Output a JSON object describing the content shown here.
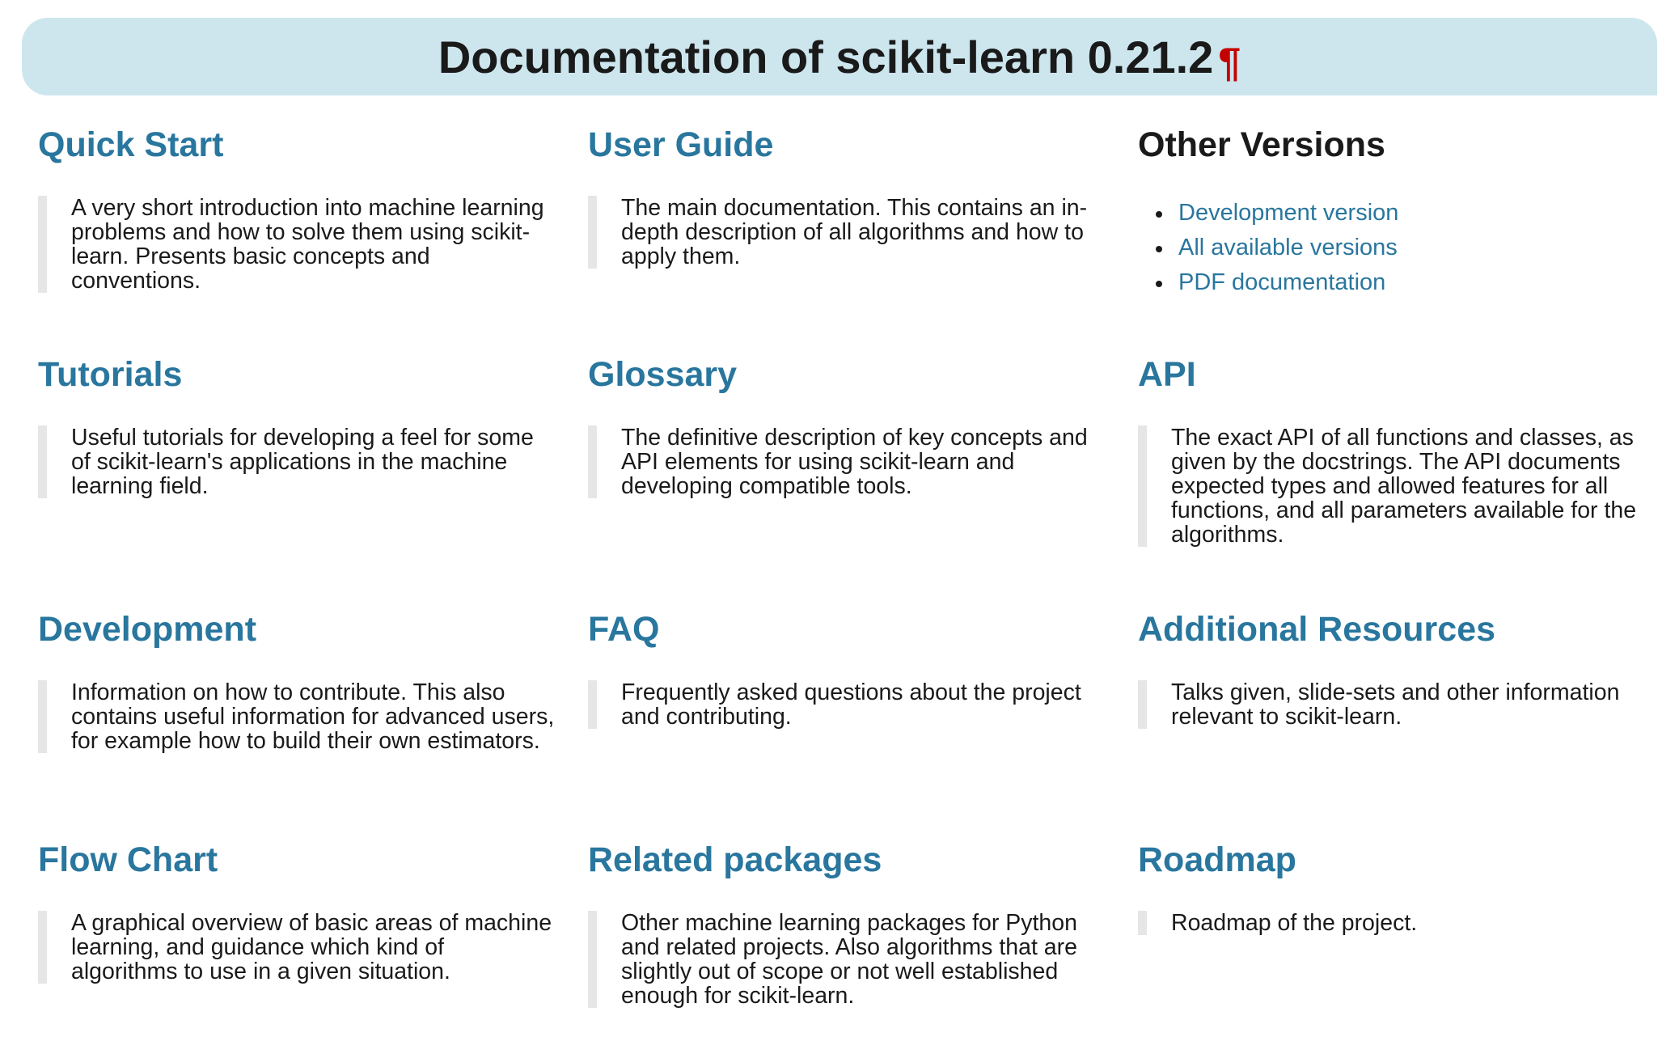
{
  "header": {
    "title": "Documentation of scikit-learn 0.21.2",
    "anchor": "¶"
  },
  "sections": {
    "quick_start": {
      "title": "Quick Start",
      "description": "A very short introduction into machine learning problems and how to solve them using scikit-learn. Presents basic concepts and conventions."
    },
    "user_guide": {
      "title": "User Guide",
      "description": "The main documentation. This contains an in-depth description of all algorithms and how to apply them."
    },
    "other_versions": {
      "title": "Other Versions",
      "links": [
        "Development version",
        "All available versions",
        "PDF documentation"
      ]
    },
    "tutorials": {
      "title": "Tutorials",
      "description": "Useful tutorials for developing a feel for some of scikit-learn's applications in the machine learning field."
    },
    "glossary": {
      "title": "Glossary",
      "description": "The definitive description of key concepts and API elements for using scikit-learn and developing compatible tools."
    },
    "api": {
      "title": "API",
      "description": "The exact API of all functions and classes, as given by the docstrings. The API documents expected types and allowed features for all functions, and all parameters available for the algorithms."
    },
    "development": {
      "title": "Development",
      "description": "Information on how to contribute. This also contains useful information for advanced users, for example how to build their own estimators."
    },
    "faq": {
      "title": "FAQ",
      "description": "Frequently asked questions about the project and contributing."
    },
    "additional_resources": {
      "title": "Additional Resources",
      "description": "Talks given, slide-sets and other information relevant to scikit-learn."
    },
    "flow_chart": {
      "title": "Flow Chart",
      "description": "A graphical overview of basic areas of machine learning, and guidance which kind of algorithms to use in a given situation."
    },
    "related_packages": {
      "title": "Related packages",
      "description": "Other machine learning packages for Python and related projects. Also algorithms that are slightly out of scope or not well established enough for scikit-learn."
    },
    "roadmap": {
      "title": "Roadmap",
      "description": "Roadmap of the project."
    }
  },
  "colors": {
    "link": "#29769e",
    "banner_background": "#cde6ee",
    "anchor": "#c40000",
    "quote_border": "#e6e6e6"
  }
}
